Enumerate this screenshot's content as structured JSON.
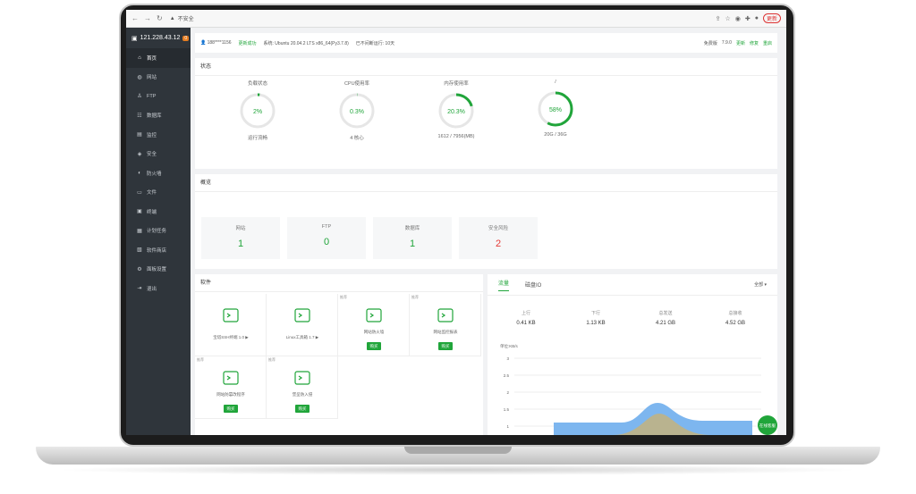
{
  "browser": {
    "insecure": "不安全",
    "update": "更新"
  },
  "sidebar": {
    "server": "121.228.43.12",
    "badge": "0",
    "items": [
      {
        "label": "首页",
        "icon": "home-icon",
        "active": true
      },
      {
        "label": "网站",
        "icon": "globe-icon"
      },
      {
        "label": "FTP",
        "icon": "person-icon"
      },
      {
        "label": "数据库",
        "icon": "database-icon"
      },
      {
        "label": "监控",
        "icon": "monitor-icon"
      },
      {
        "label": "安全",
        "icon": "shield-icon"
      },
      {
        "label": "防火墙",
        "icon": "firewall-icon"
      },
      {
        "label": "文件",
        "icon": "folder-icon"
      },
      {
        "label": "终端",
        "icon": "terminal-icon"
      },
      {
        "label": "计划任务",
        "icon": "calendar-icon"
      },
      {
        "label": "软件商店",
        "icon": "store-icon"
      },
      {
        "label": "面板设置",
        "icon": "gear-icon"
      },
      {
        "label": "退出",
        "icon": "logout-icon"
      }
    ]
  },
  "topbar": {
    "user": "188****1156",
    "verified": "更新成功",
    "system": "系统: Ubuntu 20.04.2 LTS x86_64(Py3.7.8)",
    "uptime": "已不间断运行: 10天",
    "edition": "免费版",
    "version": "7.9.0",
    "update_link": "更新",
    "fix_link": "修复",
    "restart_link": "重启"
  },
  "status": {
    "title": "状态",
    "gauges": [
      {
        "label": "负载状态",
        "value": 2,
        "text": "2%",
        "sub": "运行流畅"
      },
      {
        "label": "CPU使用率",
        "value": 0.3,
        "text": "0.3%",
        "sub": "4 核心"
      },
      {
        "label": "内存使用率",
        "value": 20.3,
        "text": "20.3%",
        "sub": "1612 / 7956(MB)"
      },
      {
        "label": "/",
        "value": 58,
        "text": "58%",
        "sub": "20G / 36G"
      }
    ]
  },
  "overview": {
    "title": "概览",
    "stats": [
      {
        "label": "网站",
        "value": "1"
      },
      {
        "label": "FTP",
        "value": "0"
      },
      {
        "label": "数据库",
        "value": "1"
      },
      {
        "label": "安全风险",
        "value": "2"
      }
    ]
  },
  "software": {
    "title": "软件",
    "items": [
      {
        "name": "宝塔SSH终端 1.0 ▶",
        "icon": "terminal-icon",
        "tag": "",
        "buy": ""
      },
      {
        "name": "Linux工具箱 1.7 ▶",
        "icon": "tools-icon",
        "tag": "",
        "buy": ""
      },
      {
        "name": "网站防火墙",
        "icon": "waf-icon",
        "tag": "推荐",
        "buy": "购买"
      },
      {
        "name": "网站监控报表",
        "icon": "target-icon",
        "tag": "推荐",
        "buy": "购买"
      },
      {
        "name": "网站防篡改程序",
        "icon": "lock-doc-icon",
        "tag": "推荐",
        "buy": "购买"
      },
      {
        "name": "堡垒防入侵",
        "icon": "guard-icon",
        "tag": "推荐",
        "buy": "购买"
      }
    ]
  },
  "traffic": {
    "tabs": [
      "流量",
      "磁盘IO"
    ],
    "select": "全部 ▾",
    "items": [
      {
        "label": "上行",
        "value": "0.41 KB"
      },
      {
        "label": "下行",
        "value": "1.13 KB"
      },
      {
        "label": "总发送",
        "value": "4.21 GB"
      },
      {
        "label": "总接收",
        "value": "4.52 GB"
      }
    ],
    "unit": "单位:KB/s",
    "yticks": [
      "3",
      "2.5",
      "2",
      "1.5",
      "1",
      "0.5"
    ]
  },
  "float_button": "在线客服"
}
